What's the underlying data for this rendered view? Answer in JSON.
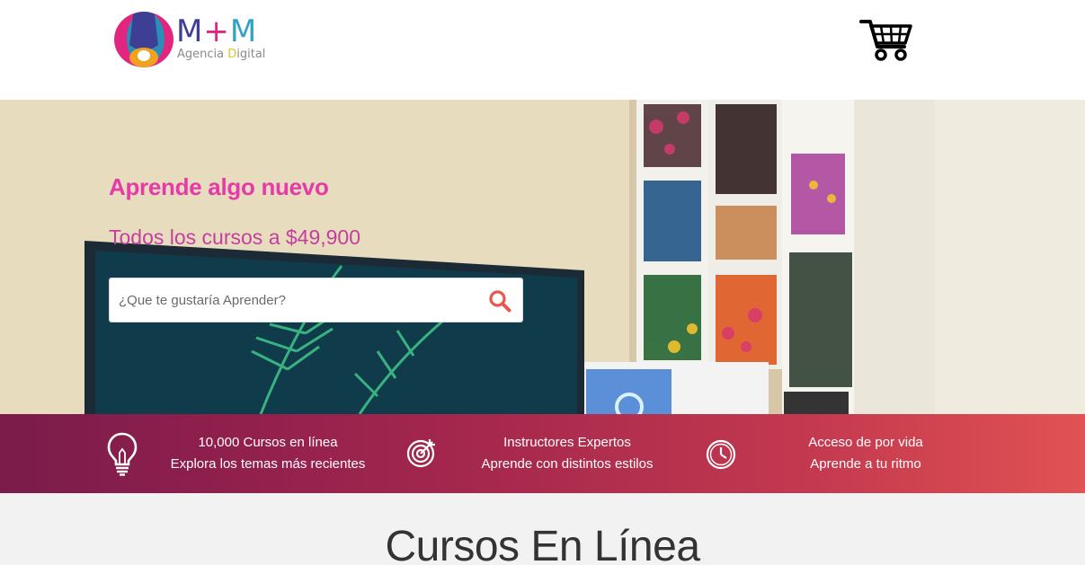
{
  "header": {
    "logo": {
      "title_m1": "M",
      "title_plus": "+",
      "title_m2": "M",
      "subtitle_part1": "Agencia ",
      "subtitle_a": "",
      "subtitle_part2": "",
      "subtitle_d": "D",
      "subtitle_part3": "igital"
    },
    "cart_icon": "shopping-cart-icon"
  },
  "hero": {
    "title": "Aprende algo nuevo",
    "subtitle": "Todos los cursos a $49,900",
    "search": {
      "placeholder": "¿Que te gustaría Aprender?",
      "value": "",
      "icon": "search-icon"
    }
  },
  "features": [
    {
      "icon": "lightbulb-icon",
      "line1": "10,000 Cursos en línea",
      "line2": "Explora los temas más recientes"
    },
    {
      "icon": "target-icon",
      "line1": "Instructores Expertos",
      "line2": "Aprende con distintos estilos"
    },
    {
      "icon": "clock-icon",
      "line1": "Acceso de por vida",
      "line2": "Aprende a tu ritmo"
    }
  ],
  "courses": {
    "title": "Cursos En Línea"
  },
  "colors": {
    "hero_title": "#e53aa7",
    "hero_subtitle": "#c43f9e",
    "search_icon": "#e8574e",
    "band_start": "#7a1c4a",
    "band_end": "#e05253",
    "section_bg": "#f3f2f2"
  }
}
